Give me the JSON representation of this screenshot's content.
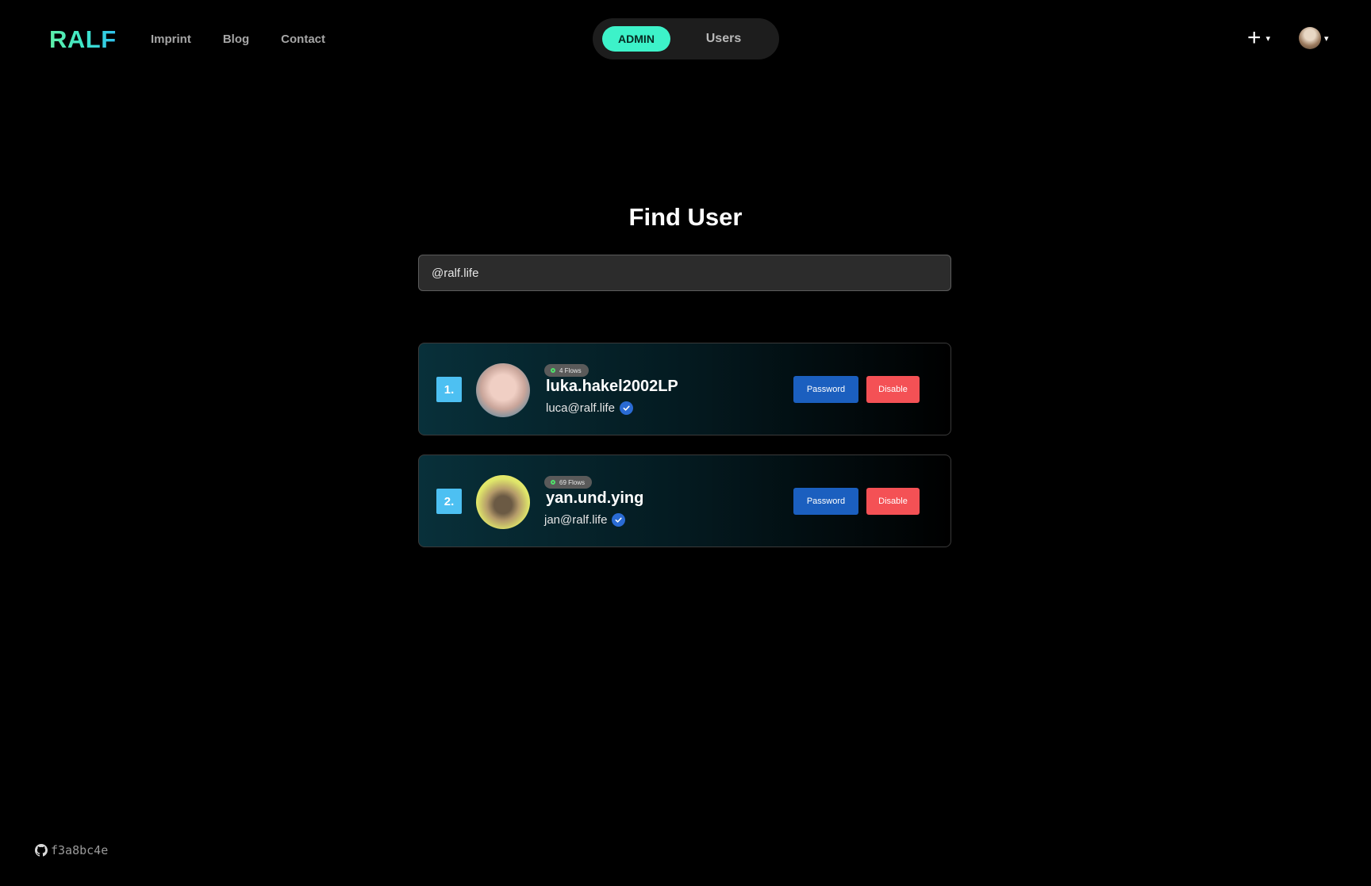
{
  "header": {
    "logo": "RALF",
    "nav": [
      "Imprint",
      "Blog",
      "Contact"
    ],
    "mode_switch": {
      "active": "ADMIN",
      "inactive": "Users"
    },
    "add_label": "+",
    "caret": "▾"
  },
  "main": {
    "title": "Find User",
    "search": {
      "value": "@ralf.life",
      "placeholder": ""
    }
  },
  "users": [
    {
      "rank": "1.",
      "flows": "4 Flows",
      "username": "luka.hakel2002LP",
      "email": "luca@ralf.life",
      "verified": true,
      "password_label": "Password",
      "disable_label": "Disable"
    },
    {
      "rank": "2.",
      "flows": "69 Flows",
      "username": "yan.und.ying",
      "email": "jan@ralf.life",
      "verified": true,
      "password_label": "Password",
      "disable_label": "Disable"
    }
  ],
  "footer": {
    "commit": "f3a8bc4e",
    "icon": "github-icon"
  },
  "colors": {
    "accent": "#3df2c9",
    "primary_button": "#1b5fbf",
    "danger_button": "#f45155",
    "rank_badge": "#4dc0f2"
  }
}
